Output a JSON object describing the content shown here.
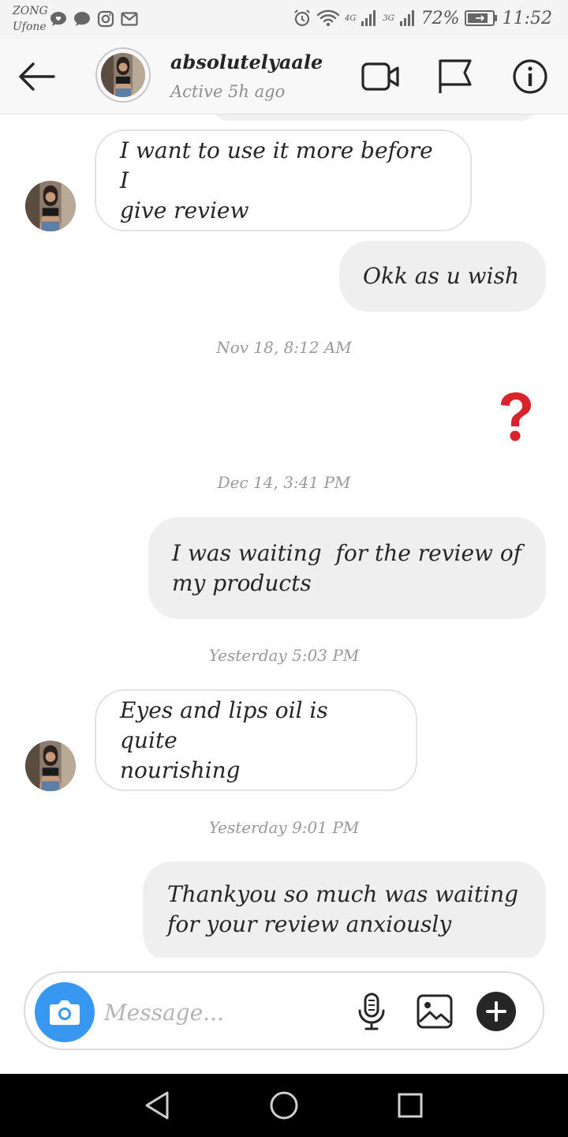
{
  "status_bar": {
    "carrier_1": "ZONG",
    "carrier_2": "Ufone",
    "network_1": "4G",
    "network_2": "3G",
    "battery": "72%",
    "time": "11:52"
  },
  "header": {
    "username": "absolutelyaale",
    "status": "Active 5h ago",
    "icons": [
      "back-arrow-icon",
      "video-call-icon",
      "flag-icon",
      "info-icon"
    ]
  },
  "messages": [
    {
      "type": "incoming",
      "text_line1": "I want to use it more before I",
      "text_line2": "give review"
    },
    {
      "type": "outgoing",
      "text": "Okk as u wish"
    },
    {
      "type": "timestamp",
      "text": "Nov 18, 8:12 AM"
    },
    {
      "type": "outgoing-emoji",
      "text": "❓"
    },
    {
      "type": "timestamp",
      "text": "Dec 14, 3:41 PM"
    },
    {
      "type": "outgoing",
      "text_line1": "I was waiting  for the review of",
      "text_line2": "my products"
    },
    {
      "type": "timestamp",
      "text": "Yesterday 5:03 PM"
    },
    {
      "type": "incoming",
      "text_line1": "Eyes and lips oil is quite",
      "text_line2": "nourishing"
    },
    {
      "type": "timestamp",
      "text": "Yesterday 9:01 PM"
    },
    {
      "type": "outgoing",
      "text_line1": "Thankyou so much was waiting",
      "text_line2": "for your review anxiously"
    }
  ],
  "composer": {
    "placeholder": "Message...",
    "value": "",
    "icons": [
      "camera-icon",
      "microphone-icon",
      "gallery-icon",
      "plus-icon"
    ]
  },
  "colors": {
    "accent": "#3897f0",
    "incoming_bubble": "#ffffff",
    "outgoing_bubble": "#efefef",
    "emoji_red": "#d8232a"
  }
}
